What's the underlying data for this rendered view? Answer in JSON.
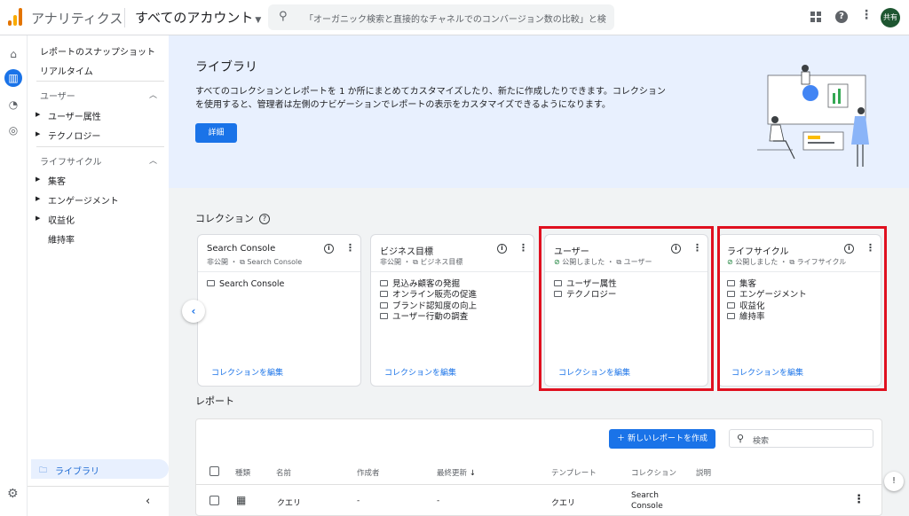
{
  "header": {
    "app_name": "アナリティクス",
    "account": "すべてのアカウント",
    "search_placeholder": "「オーガニック検索と直接的なチャネルでのコンバージョン数の比較」と検…",
    "avatar_initials": "共有",
    "icons": [
      "apps-icon",
      "help-icon",
      "more-vert-icon"
    ]
  },
  "rail": {
    "icons": [
      "home-icon",
      "reports-icon",
      "explore-icon",
      "advertising-icon"
    ]
  },
  "nav": {
    "snapshot": "レポートのスナップショット",
    "realtime": "リアルタイム",
    "sections": [
      {
        "title": "ユーザー",
        "items": [
          "ユーザー属性",
          "テクノロジー"
        ]
      },
      {
        "title": "ライフサイクル",
        "items": [
          "集客",
          "エンゲージメント",
          "収益化",
          "維持率"
        ]
      }
    ],
    "library": "ライブラリ"
  },
  "banner": {
    "title": "ライブラリ",
    "description": "すべてのコレクションとレポートを 1 か所にまとめてカスタマイズしたり、新たに作成したりできます。コレクションを使用すると、管理者は左側のナビゲーションでレポートの表示をカスタマイズできるようになります。",
    "details_button": "詳細"
  },
  "collections": {
    "title": "コレクション",
    "edit_label": "コレクションを編集",
    "cards": [
      {
        "title": "Search Console",
        "status": "非公開",
        "template": "Search Console",
        "published": false,
        "items": [
          "Search Console"
        ]
      },
      {
        "title": "ビジネス目標",
        "status": "非公開",
        "template": "ビジネス目標",
        "published": false,
        "items": [
          "見込み顧客の発掘",
          "オンライン販売の促進",
          "ブランド認知度の向上",
          "ユーザー行動の調査"
        ]
      },
      {
        "title": "ユーザー",
        "status": "公開しました",
        "template": "ユーザー",
        "published": true,
        "items": [
          "ユーザー属性",
          "テクノロジー"
        ]
      },
      {
        "title": "ライフサイクル",
        "status": "公開しました",
        "template": "ライフサイクル",
        "published": true,
        "items": [
          "集客",
          "エンゲージメント",
          "収益化",
          "維持率"
        ]
      }
    ]
  },
  "reports": {
    "title": "レポート",
    "new_button": "新しいレポートを作成",
    "search_placeholder": "検索",
    "columns": [
      "種類",
      "名前",
      "作成者",
      "最終更新",
      "テンプレート",
      "コレクション",
      "説明"
    ],
    "sort_indicator": "↓",
    "rows": [
      {
        "name": "クエリ",
        "author": "-",
        "updated": "-",
        "template": "クエリ",
        "collection": "Search Console",
        "description": ""
      }
    ]
  },
  "colors": {
    "primary": "#1a73e8",
    "banner_bg": "#e8f0fe",
    "highlight": "#e0101f",
    "published": "#188038"
  }
}
